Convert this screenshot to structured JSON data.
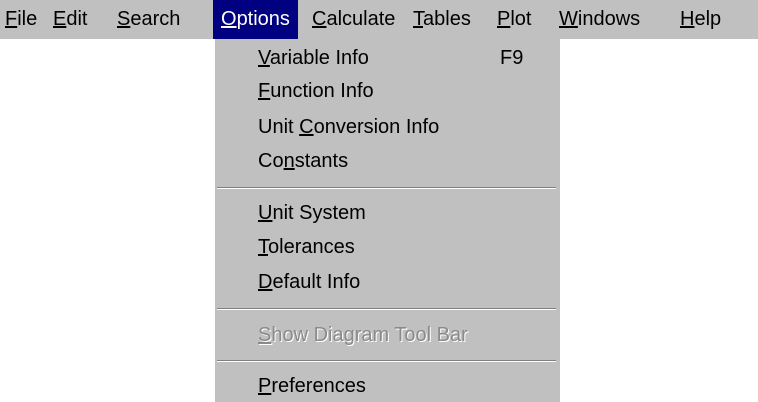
{
  "menubar": {
    "items": [
      {
        "label": "File",
        "mnemonic": "F",
        "rest": "ile"
      },
      {
        "label": "Edit",
        "mnemonic": "E",
        "rest": "dit"
      },
      {
        "label": "Search",
        "mnemonic": "S",
        "rest": "earch"
      },
      {
        "label": "Options",
        "mnemonic": "O",
        "rest": "ptions"
      },
      {
        "label": "Calculate",
        "mnemonic": "C",
        "rest": "alculate"
      },
      {
        "label": "Tables",
        "mnemonic": "T",
        "rest": "ables"
      },
      {
        "label": "Plot",
        "mnemonic": "P",
        "rest": "lot"
      },
      {
        "label": "Windows",
        "mnemonic": "W",
        "rest": "indows"
      },
      {
        "label": "Help",
        "mnemonic": "H",
        "rest": "elp"
      }
    ],
    "active": "Options"
  },
  "options_menu": {
    "items": [
      {
        "label": "Variable Info",
        "pre": "",
        "mnemonic": "V",
        "rest": "ariable Info",
        "shortcut": "F9"
      },
      {
        "label": "Function Info",
        "pre": "",
        "mnemonic": "F",
        "rest": "unction Info"
      },
      {
        "label": "Unit Conversion Info",
        "pre": "Unit ",
        "mnemonic": "C",
        "rest": "onversion Info"
      },
      {
        "label": "Constants",
        "pre": "Co",
        "mnemonic": "n",
        "rest": "stants"
      },
      {
        "label": "Unit System",
        "pre": "",
        "mnemonic": "U",
        "rest": "nit System"
      },
      {
        "label": "Tolerances",
        "pre": "",
        "mnemonic": "T",
        "rest": "olerances"
      },
      {
        "label": "Default Info",
        "pre": "",
        "mnemonic": "D",
        "rest": "efault Info"
      },
      {
        "label": "Show Diagram Tool Bar",
        "pre": "",
        "mnemonic": "S",
        "rest": "how Diagram Tool Bar",
        "disabled": true
      },
      {
        "label": "Preferences",
        "pre": "",
        "mnemonic": "P",
        "rest": "references"
      }
    ]
  },
  "colors": {
    "menu_background": "#c0c0c0",
    "highlight": "#000080",
    "disabled_text": "#8a8a8a"
  }
}
